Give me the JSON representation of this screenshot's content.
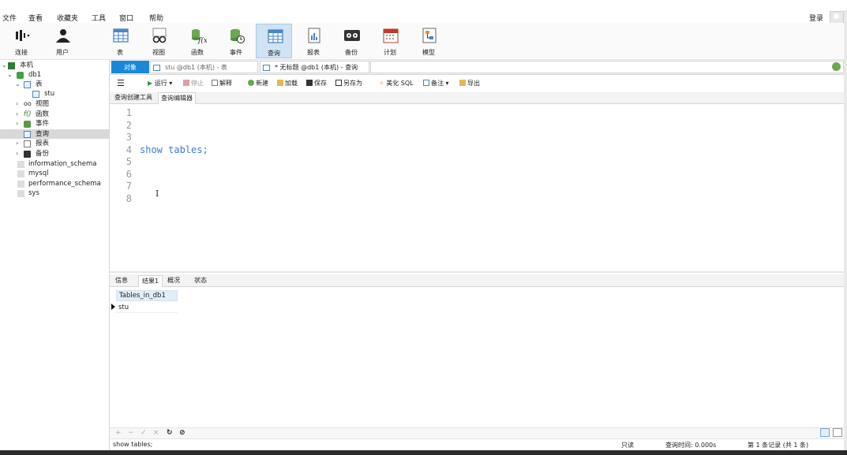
{
  "menu": [
    "文件",
    "查看",
    "收藏夹",
    "工具",
    "窗口",
    "帮助"
  ],
  "login_label": "登录",
  "toolbar": [
    {
      "label": "连接",
      "icon": "connect-icon"
    },
    {
      "label": "用户",
      "icon": "user-icon"
    },
    {
      "label": "表",
      "icon": "table-icon"
    },
    {
      "label": "视图",
      "icon": "view-icon"
    },
    {
      "label": "函数",
      "icon": "function-icon"
    },
    {
      "label": "事件",
      "icon": "event-icon"
    },
    {
      "label": "查询",
      "icon": "query-icon"
    },
    {
      "label": "报表",
      "icon": "report-icon"
    },
    {
      "label": "备份",
      "icon": "backup-icon"
    },
    {
      "label": "计划",
      "icon": "schedule-icon"
    },
    {
      "label": "模型",
      "icon": "model-icon"
    }
  ],
  "toolbar_active": "查询",
  "tree": {
    "connection": "本机",
    "database": "db1",
    "tables_label": "表",
    "table_stu": "stu",
    "views_label": "视图",
    "functions_label": "函数",
    "events_label": "事件",
    "queries_label": "查询",
    "reports_label": "报表",
    "backups_label": "备份",
    "other_databases": [
      "information_schema",
      "mysql",
      "performance_schema",
      "sys"
    ]
  },
  "tabs": {
    "objects": "对象",
    "tab1": "stu @db1 (本机) - 表",
    "tab2": "* 无标题 @db1 (本机) - 查询"
  },
  "query_toolbar": {
    "run": "运行",
    "stop": "停止",
    "explain": "解释",
    "new": "新建",
    "load": "加载",
    "save": "保存",
    "save_as": "另存为",
    "beautify": "美化 SQL",
    "comment": "备注",
    "export": "导出"
  },
  "subtabs": {
    "builder": "查询创建工具",
    "editor": "查询编辑器"
  },
  "editor": {
    "line_numbers": [
      "1",
      "2",
      "3",
      "4",
      "5",
      "6",
      "7",
      "8"
    ],
    "line4": "show tables;"
  },
  "result_tabs": {
    "info": "信息",
    "result1": "结果1",
    "profile": "概况",
    "status": "状态"
  },
  "results": {
    "column": "Tables_in_db1",
    "rows": [
      "stu"
    ]
  },
  "status": {
    "sql": "show tables;",
    "readonly": "只读",
    "query_time": "查询时间: 0.000s",
    "record": "第 1 条记录 (共 1 条)"
  }
}
